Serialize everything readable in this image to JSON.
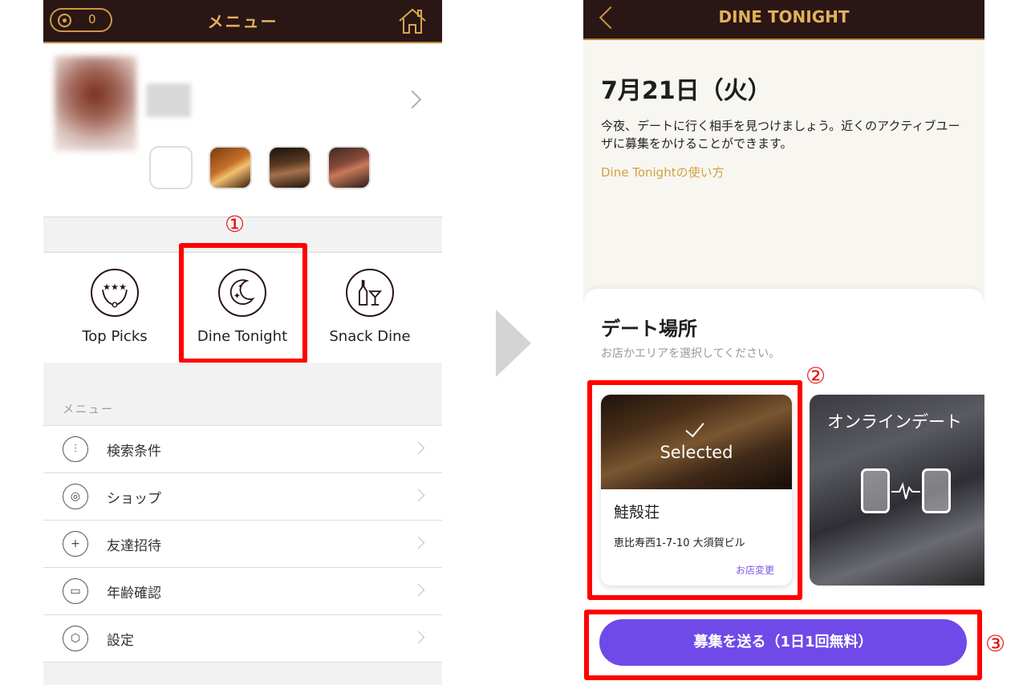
{
  "left": {
    "coin_count": "0",
    "title": "メニュー",
    "features": [
      {
        "label": "Top Picks"
      },
      {
        "label": "Dine Tonight"
      },
      {
        "label": "Snack Dine"
      }
    ],
    "menu_header": "メニュー",
    "menu_items": [
      {
        "label": "検索条件",
        "icon": "sliders-icon"
      },
      {
        "label": "ショップ",
        "icon": "shop-icon"
      },
      {
        "label": "友達招待",
        "icon": "add-friend-icon"
      },
      {
        "label": "年齢確認",
        "icon": "id-card-icon"
      },
      {
        "label": "設定",
        "icon": "settings-icon"
      }
    ]
  },
  "callouts": [
    "①",
    "②",
    "③"
  ],
  "right": {
    "title": "DINE TONIGHT",
    "date": "7月21日（火）",
    "description": "今夜、デートに行く相手を見つけましょう。近くのアクティブユーザに募集をかけることができます。",
    "howto_link": "Dine Tonightの使い方",
    "sheet_title": "デート場所",
    "sheet_subtitle": "お店かエリアを選択してください。",
    "selected_card": {
      "status": "Selected",
      "name": "鮭殻荘",
      "address": "恵比寿西1-7-10 大須賀ビル",
      "change_link": "お店変更"
    },
    "online_card": {
      "label": "オンラインデート"
    },
    "send_button": "募集を送る（1日1回無料）"
  },
  "colors": {
    "header_bg": "#2a1614",
    "gold": "#e2b15a",
    "accent_purple": "#6f4ae8",
    "highlight_red": "#ff0000"
  }
}
